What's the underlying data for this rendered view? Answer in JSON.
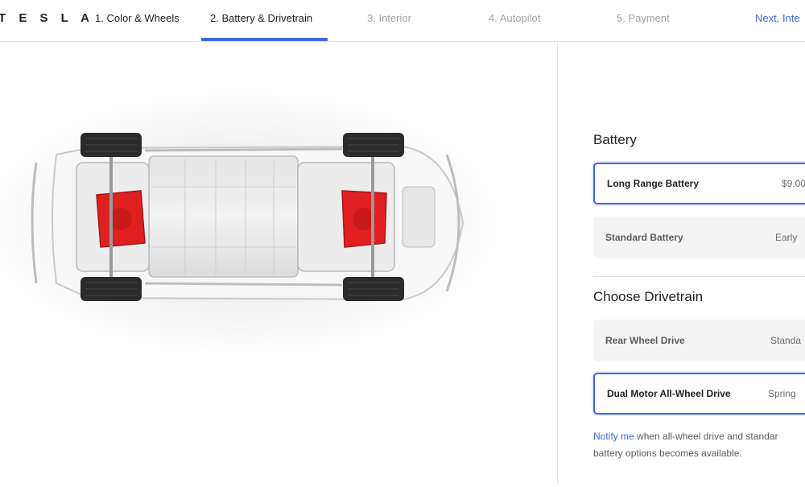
{
  "header": {
    "logo": "T E S L A",
    "steps": [
      {
        "label": "1. Color & Wheels",
        "state": "completed"
      },
      {
        "label": "2. Battery & Drivetrain",
        "state": "active"
      },
      {
        "label": "3. Interior",
        "state": "upcoming"
      },
      {
        "label": "4. Autopilot",
        "state": "upcoming"
      },
      {
        "label": "5. Payment",
        "state": "upcoming"
      }
    ],
    "next_label": "Next, Inte"
  },
  "battery": {
    "heading": "Battery",
    "options": [
      {
        "name": "Long Range Battery",
        "price": "$9,00",
        "selected": true
      },
      {
        "name": "Standard Battery",
        "price": "Early",
        "selected": false
      }
    ]
  },
  "drivetrain": {
    "heading": "Choose Drivetrain",
    "options": [
      {
        "name": "Rear Wheel Drive",
        "price": "Standa",
        "selected": false
      },
      {
        "name": "Dual Motor All-Wheel Drive",
        "price": "Spring",
        "selected": true
      }
    ]
  },
  "note": {
    "link": "Notify me",
    "line1": " when all-wheel drive and standar",
    "line2": "battery options becomes available."
  },
  "colors": {
    "accent": "#3e6ae1",
    "motor_red": "#e02020",
    "chassis": "#c9c9c9"
  },
  "image": {
    "alt_icon": "car-chassis-dual-motor-image"
  }
}
